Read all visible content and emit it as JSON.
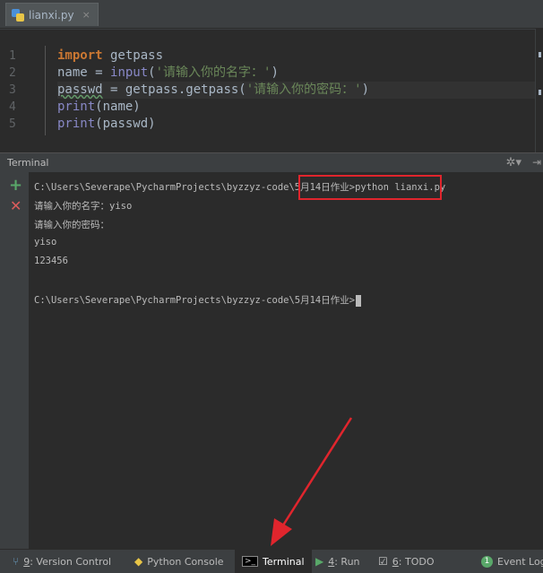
{
  "tab": {
    "name": "lianxi.py",
    "close": "×"
  },
  "editor": {
    "line_numbers": [
      "1",
      "2",
      "3",
      "4",
      "5"
    ],
    "lines": [
      {
        "parts": [
          {
            "c": "kw",
            "t": "import"
          },
          {
            "c": "",
            "t": " getpass"
          }
        ]
      },
      {
        "parts": [
          {
            "c": "",
            "t": "name = "
          },
          {
            "c": "fn",
            "t": "input"
          },
          {
            "c": "",
            "t": "("
          },
          {
            "c": "str",
            "t": "'请输入你的名字：'"
          },
          {
            "c": "",
            "t": ")"
          }
        ]
      },
      {
        "parts": [
          {
            "c": "squig",
            "t": "passwd"
          },
          {
            "c": "",
            "t": " = getpass.getpass("
          },
          {
            "c": "str",
            "t": "'请输入你的密码：'"
          },
          {
            "c": "",
            "t": ")"
          }
        ]
      },
      {
        "parts": [
          {
            "c": "fn",
            "t": "print"
          },
          {
            "c": "",
            "t": "(name)"
          }
        ]
      },
      {
        "parts": [
          {
            "c": "fn",
            "t": "print"
          },
          {
            "c": "",
            "t": "(passwd)"
          }
        ]
      }
    ]
  },
  "terminal": {
    "title": "Terminal",
    "prompt_path": "C:\\Users\\Severape\\PycharmProjects\\byzzyz-code\\5月14日作业>",
    "command": "python lianxi.py",
    "output": [
      "请输入你的名字：yiso",
      "请输入你的密码：",
      "yiso",
      "123456"
    ],
    "last_prompt": "C:\\Users\\Severape\\PycharmProjects\\byzzyz-code\\5月14日作业>"
  },
  "statusbar": {
    "items": [
      {
        "key": "9",
        "label": ": Version Control",
        "icon": "version-control-icon"
      },
      {
        "key": "",
        "label": "Python Console",
        "icon": "python-console-icon"
      },
      {
        "key": "",
        "label": "Terminal",
        "icon": "terminal-icon",
        "active": true
      },
      {
        "key": "4",
        "label": ": Run",
        "icon": "run-icon"
      },
      {
        "key": "6",
        "label": ": TODO",
        "icon": "todo-icon"
      },
      {
        "key": "",
        "label": "Event Log",
        "icon": "event-log-icon",
        "badge": "1"
      }
    ]
  },
  "colors": {
    "keyword": "#cc7832",
    "string": "#6a8759",
    "builtin": "#8888c6",
    "highlight_box": "#e0252d"
  }
}
